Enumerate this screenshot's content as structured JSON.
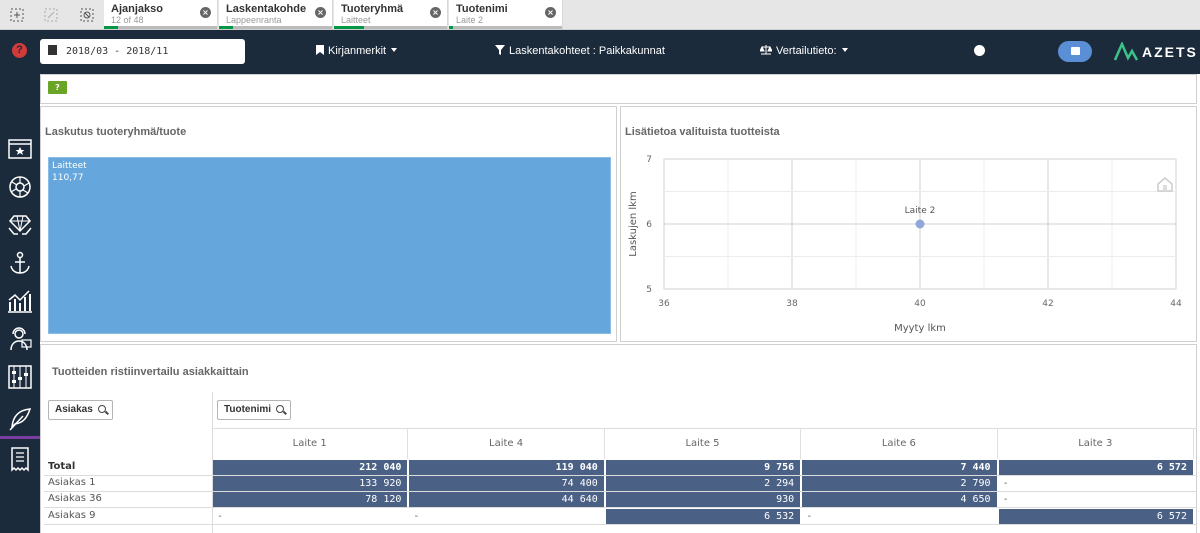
{
  "selections": [
    {
      "title": "Ajanjakso",
      "subtitle": "12 of 48"
    },
    {
      "title": "Laskentakohde",
      "subtitle": "Lappeenranta"
    },
    {
      "title": "Tuoteryhmä",
      "subtitle": "Laitteet"
    },
    {
      "title": "Tuotenimi",
      "subtitle": "Laite 2"
    }
  ],
  "toolbar": {
    "date_range": "2018/03 - 2018/11",
    "bookmarks": "Kirjanmerkit",
    "filter": "Laskentakohteet : Paikkakunnat",
    "compare": "Vertailutieto:",
    "logo_text": "AZETS",
    "help": "?"
  },
  "note_button": "?",
  "treemap": {
    "title": "Laskutus tuoteryhmä/tuote",
    "cell_label": "Laitteet",
    "cell_value": "110,77"
  },
  "scatter": {
    "title": "Lisätietoa valituista tuotteista",
    "chart_data": {
      "type": "scatter",
      "xlabel": "Myyty lkm",
      "ylabel": "Laskujen lkm",
      "xlim": [
        36,
        44
      ],
      "ylim": [
        5,
        7
      ],
      "xticks": [
        "36",
        "38",
        "40",
        "42",
        "44"
      ],
      "yticks": [
        "5",
        "6",
        "7"
      ],
      "points": [
        {
          "label": "Laite 2",
          "x": 40,
          "y": 6
        }
      ]
    }
  },
  "table": {
    "title": "Tuotteiden ristiinvertailu asiakkaittain",
    "row_dim": "Asiakas",
    "col_dim": "Tuotenimi",
    "columns": [
      "Laite 1",
      "Laite 4",
      "Laite 5",
      "Laite 6",
      "Laite 3"
    ],
    "rows": [
      {
        "label": "Total",
        "values": [
          "212 040",
          "119 040",
          "9 756",
          "7 440",
          "6 572"
        ]
      },
      {
        "label": "Asiakas 1",
        "values": [
          "133 920",
          "74 400",
          "2 294",
          "2 790",
          "-"
        ]
      },
      {
        "label": "Asiakas 36",
        "values": [
          "78 120",
          "44 640",
          "930",
          "4 650",
          "-"
        ]
      },
      {
        "label": "Asiakas 9",
        "values": [
          "-",
          "-",
          "6 532",
          "-",
          "6 572"
        ]
      }
    ]
  },
  "colors": {
    "header_bg": "#1c2b3b",
    "treemap_fill": "#65a6dc",
    "point": "#8fa8d8",
    "cell_dark": "#4a6085",
    "accent_green": "#009845"
  }
}
